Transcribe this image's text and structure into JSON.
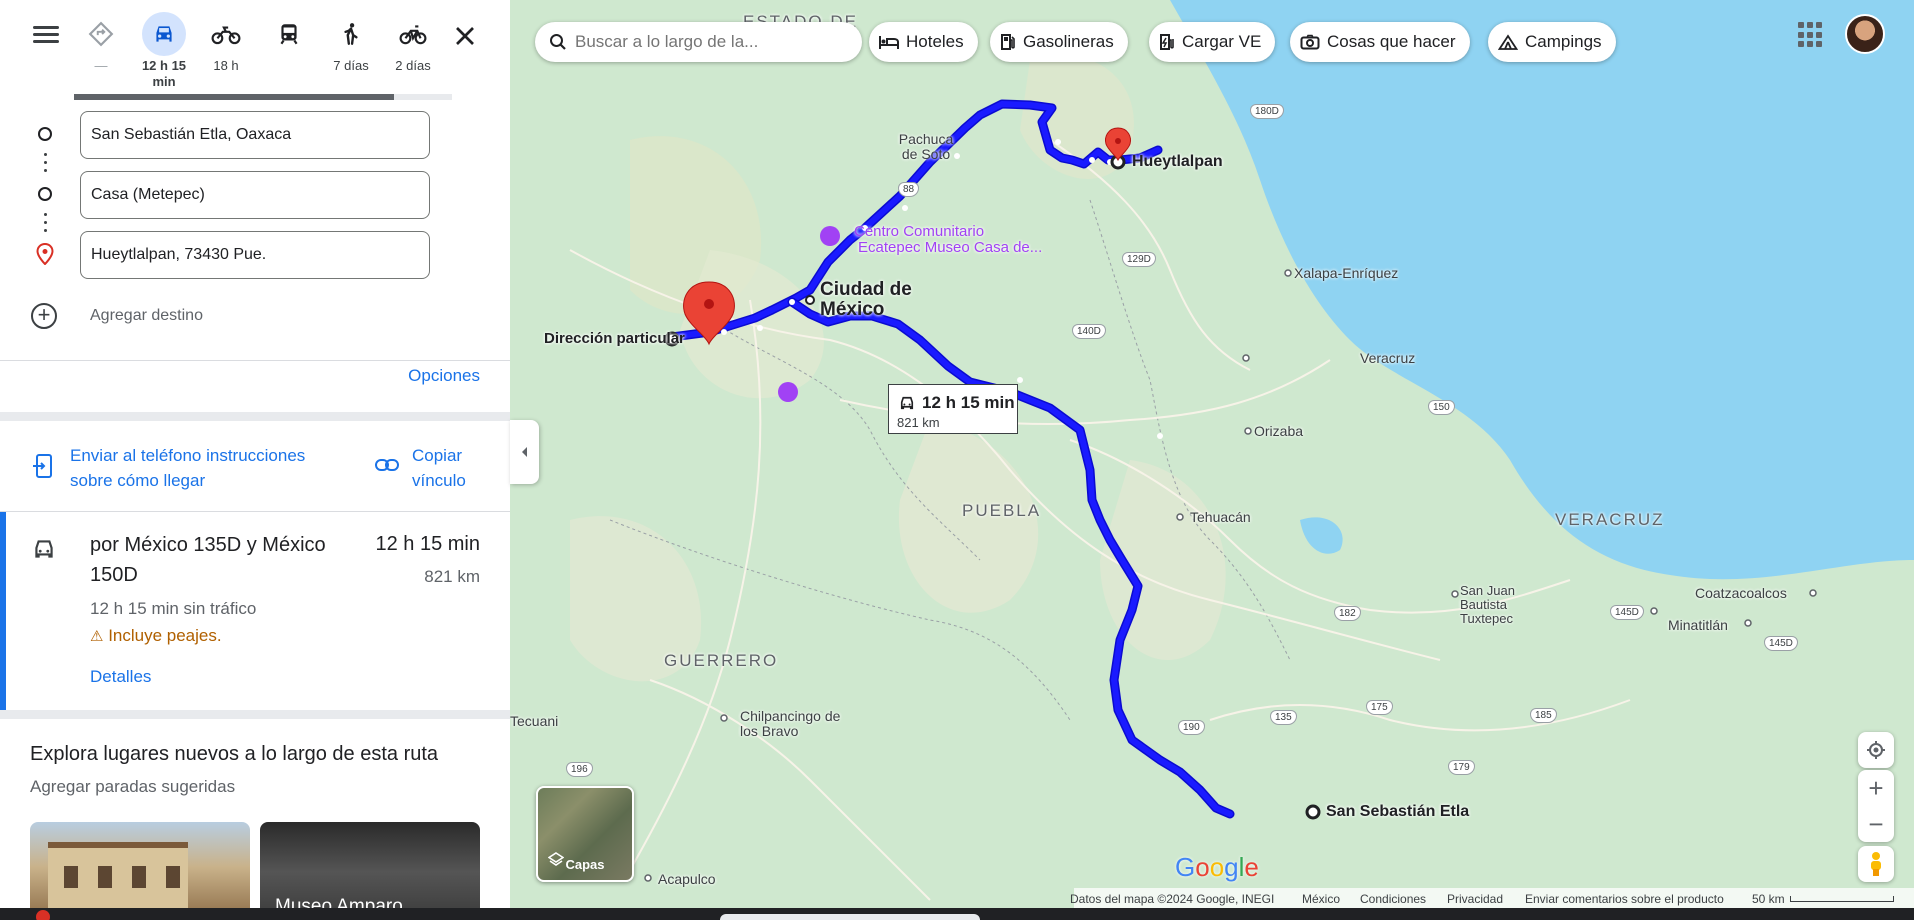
{
  "directions": {
    "modes": [
      {
        "name": "best-mode-icon",
        "label": "—",
        "active": false
      },
      {
        "name": "car-mode-icon",
        "label": "12 h 15 min",
        "active": true
      },
      {
        "name": "motorcycle-mode-icon",
        "label": "18 h",
        "active": false
      },
      {
        "name": "transit-mode-icon",
        "label": "",
        "active": false
      },
      {
        "name": "walk-mode-icon",
        "label": "7 días",
        "active": false
      },
      {
        "name": "bicycle-mode-icon",
        "label": "2 días",
        "active": false
      }
    ],
    "stops": [
      "San Sebastián Etla, Oaxaca",
      "Casa (Metepec)",
      "Hueytlalpan, 73430 Pue."
    ],
    "add_destination": "Agregar destino",
    "options": "Opciones",
    "send_to_phone": "Enviar al teléfono instrucciones sobre cómo llegar",
    "copy_link": "Copiar vínculo",
    "route": {
      "via": "por México 135D y México 150D",
      "time": "12 h 15 min",
      "distance": "821 km",
      "no_traffic": "12 h 15 min sin tráfico",
      "warning": "Incluye peajes.",
      "details": "Detalles"
    },
    "explore_title": "Explora lugares nuevos a lo largo de esta ruta",
    "explore_subtitle": "Agregar paradas sugeridas",
    "suggestion_thumb_label": "Museo Amparo"
  },
  "map": {
    "search_placeholder": "Buscar a lo largo de la...",
    "chips": [
      "Hoteles",
      "Gasolineras",
      "Cargar VE",
      "Cosas que hacer",
      "Campings"
    ],
    "duration_label": "12 h 15 min",
    "duration_distance": "821 km",
    "labels": {
      "estado_de": "ESTADO DE",
      "pachuca": "Pachuca de Soto",
      "hueytlalpan": "Hueytlalpan",
      "centro_comunitario": "Centro Comunitario",
      "ecatepec": "Ecatepec Museo Casa de...",
      "cdmx": "Ciudad de México",
      "direccion_particular": "Dirección particular",
      "xalapa": "Xalapa-Enríquez",
      "veracruz_city": "Veracruz",
      "orizaba": "Orizaba",
      "puebla": "PUEBLA",
      "tehuacan": "Tehuacán",
      "veracruz_state": "VERACRUZ",
      "guerrero": "GUERRERO",
      "san_juan": "San Juan Bautista Tuxtepec",
      "coatzacoalcos": "Coatzacoalcos",
      "minatitlan": "Minatitlán",
      "chilpancingo": "Chilpancingo de los Bravo",
      "tecuani": "Tecuani",
      "acapulco": "Acapulco",
      "san_sebastian": "San Sebastián Etla"
    },
    "shields": [
      "180D",
      "88",
      "129D",
      "140D",
      "150",
      "182",
      "145D",
      "190",
      "135",
      "175",
      "185",
      "179",
      "196",
      "145D"
    ],
    "layers_label": "Capas",
    "google_logo": "Google",
    "footer": {
      "data": "Datos del mapa ©2024 Google, INEGI",
      "country": "México",
      "terms": "Condiciones",
      "privacy": "Privacidad",
      "feedback": "Enviar comentarios sobre el producto",
      "scale": "50 km"
    },
    "route_color": "#1a1aff",
    "water_color": "#8fd3f2",
    "land_color": "#cfe8cf"
  }
}
